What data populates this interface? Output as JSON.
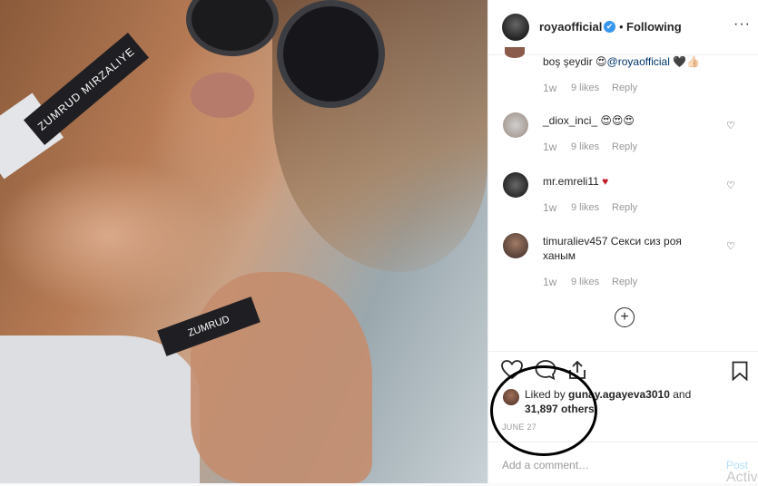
{
  "post": {
    "username": "royaofficial",
    "verified_mark": "✔",
    "follow_sep": "•",
    "follow_status": "Following",
    "more": "···"
  },
  "photo": {
    "strap_text_1": "ZUMRUD MIRZALIYE",
    "strap_text_2": "ZUMRUD"
  },
  "comments": [
    {
      "user": "",
      "text": "boş şeydir 😍",
      "mention": "@royaofficial",
      "emoji": "🖤👍🏻",
      "age": "1w",
      "likes": "9 likes",
      "reply": "Reply"
    },
    {
      "user": "_diox_inci_",
      "text": "😍😍😍",
      "age": "1w",
      "likes": "9 likes",
      "reply": "Reply"
    },
    {
      "user": "mr.emreli11",
      "text": "♥",
      "age": "1w",
      "likes": "9 likes",
      "reply": "Reply"
    },
    {
      "user": "timuraliev457",
      "text": "Секси сиз роя",
      "text2": "ханым",
      "age": "1w",
      "likes": "9 likes",
      "reply": "Reply"
    }
  ],
  "load_more": "+",
  "likes": {
    "prefix": "Liked by ",
    "user": "gunay.agayeva3010",
    "and": " and",
    "others": "31,897 others"
  },
  "date": "JUNE 27",
  "add_comment": {
    "placeholder": "Add a comment…",
    "post": "Post"
  },
  "overlay_text": "Activ",
  "icons": {
    "heart": "heart-icon",
    "comment": "comment-icon",
    "share": "share-icon",
    "bookmark": "bookmark-icon"
  }
}
